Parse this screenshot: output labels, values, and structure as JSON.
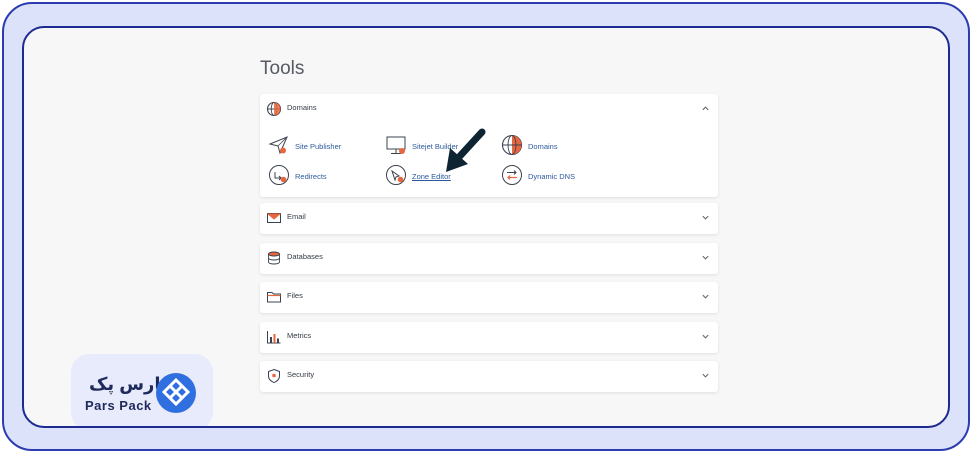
{
  "page": {
    "title": "Tools"
  },
  "panels": {
    "domains": {
      "label": "Domains",
      "expanded": true
    },
    "email": {
      "label": "Email",
      "expanded": false
    },
    "databases": {
      "label": "Databases",
      "expanded": false
    },
    "files": {
      "label": "Files",
      "expanded": false
    },
    "metrics": {
      "label": "Metrics",
      "expanded": false
    },
    "security": {
      "label": "Security",
      "expanded": false
    }
  },
  "domain_tools": [
    {
      "label": "Site Publisher",
      "icon": "paper-plane-icon"
    },
    {
      "label": "Sitejet Builder",
      "icon": "monitor-icon"
    },
    {
      "label": "Domains",
      "icon": "globe-icon"
    },
    {
      "label": "Redirects",
      "icon": "redirect-icon"
    },
    {
      "label": "Zone Editor",
      "icon": "zone-editor-icon"
    },
    {
      "label": "Dynamic DNS",
      "icon": "swap-arrows-icon"
    }
  ],
  "brand": {
    "name_fa": "پارس پک",
    "name_en": "Pars Pack"
  },
  "colors": {
    "accent_orange": "#e8663d",
    "link_blue": "#2d5a9e",
    "frame_blue": "#2c3bb0",
    "frame_bg": "#dde2fb",
    "brand_blue": "#2f6fe0",
    "arrow": "#0f2433"
  }
}
